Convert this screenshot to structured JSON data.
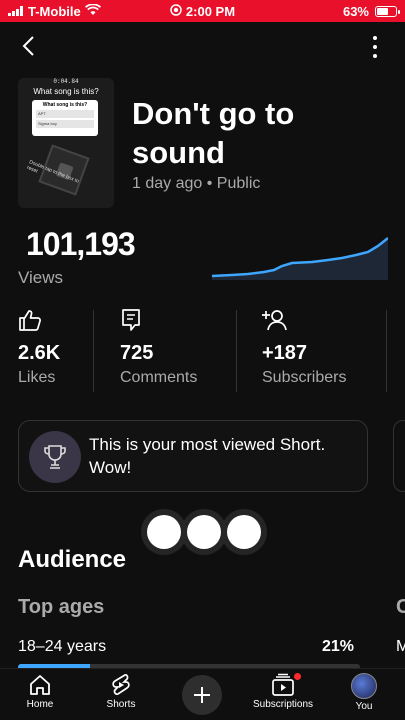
{
  "status_bar": {
    "carrier": "T-Mobile",
    "time": "2:00 PM",
    "battery": "63%",
    "battery_level": 0.63,
    "bg_color": "#e8102a"
  },
  "video": {
    "thumbnail": {
      "timestamp": "0:04.84",
      "question": "What song is this?",
      "card_title": "What song is this?",
      "option_1": "APT",
      "option_2": "Sigma boy",
      "caption": "Double tap to the box to reset"
    },
    "title": "Don't go to sound",
    "age": "1 day ago",
    "separator": "•",
    "visibility": "Public"
  },
  "views": {
    "count": "101,193",
    "label": "Views",
    "sparkline_color": "#3ea6ff"
  },
  "stats": [
    {
      "icon": "thumb-up-icon",
      "value": "2.6K",
      "label": "Likes"
    },
    {
      "icon": "comment-icon",
      "value": "725",
      "label": "Comments"
    },
    {
      "icon": "add-person-icon",
      "value": "+187",
      "label": "Subscribers"
    }
  ],
  "banner": {
    "icon": "trophy-icon",
    "text": "This is your most viewed Short. Wow!"
  },
  "audience": {
    "title": "Audience",
    "section": "Top ages",
    "next_section_initial": "C",
    "age_range": "18–24 years",
    "age_percent": "21%",
    "age_fraction": 0.21,
    "next_row_initial": "M"
  },
  "bottom_nav": {
    "home": "Home",
    "shorts": "Shorts",
    "subscriptions": "Subscriptions",
    "you": "You"
  }
}
